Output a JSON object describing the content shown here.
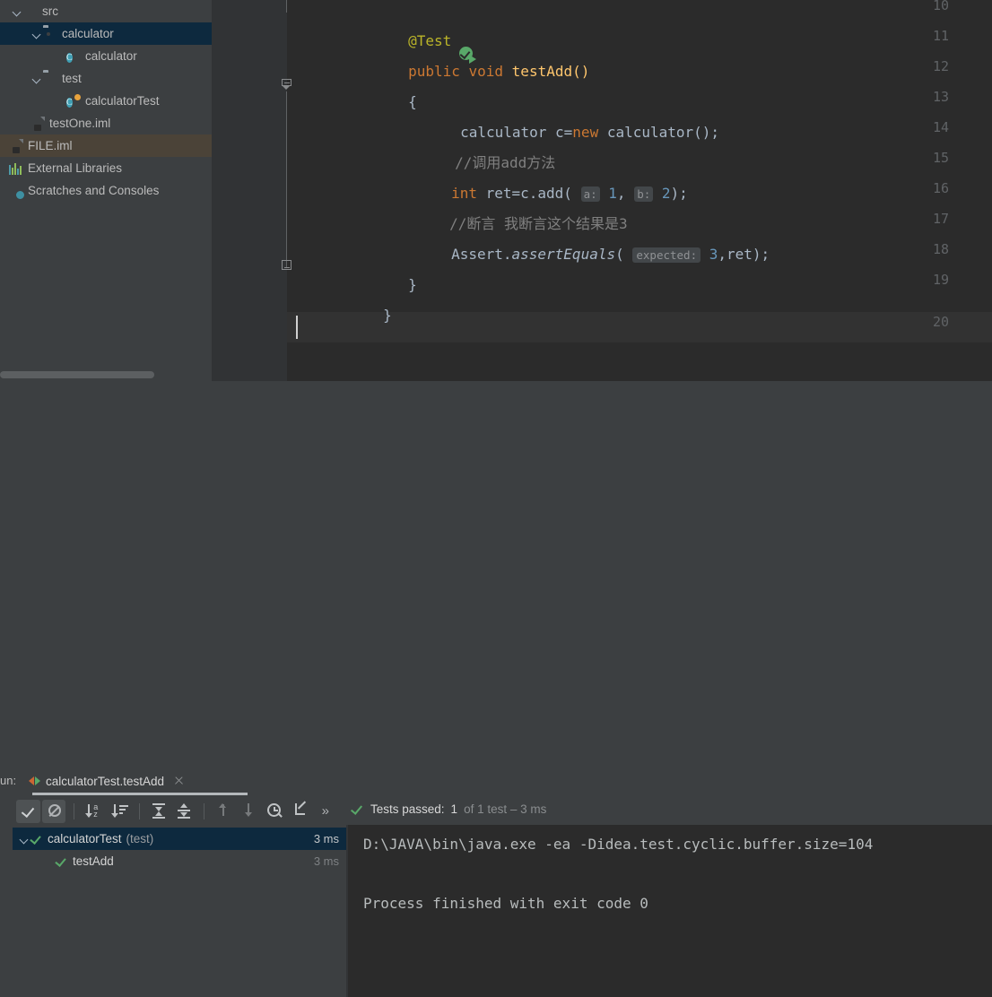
{
  "project": {
    "tree": [
      {
        "label": "src",
        "icon": "module-source-icon",
        "indent": 30,
        "chevron": true,
        "state": "normal"
      },
      {
        "label": "calculator",
        "icon": "package-folder-icon",
        "indent": 52,
        "chevron": true,
        "state": "selected"
      },
      {
        "label": "calculator",
        "icon": "java-class-icon",
        "indent": 76,
        "chevron": false,
        "state": "normal"
      },
      {
        "label": "test",
        "icon": "package-folder-icon",
        "indent": 52,
        "chevron": true,
        "state": "normal"
      },
      {
        "label": "calculatorTest",
        "icon": "java-test-class-icon",
        "indent": 76,
        "chevron": false,
        "state": "normal"
      },
      {
        "label": "testOne.iml",
        "icon": "iml-file-icon",
        "indent": 30,
        "chevron": false,
        "state": "normal"
      },
      {
        "label": "FILE.iml",
        "icon": "iml-file-icon",
        "indent": 8,
        "chevron": false,
        "state": "hover"
      },
      {
        "label": "External Libraries",
        "icon": "external-libraries-icon",
        "indent": 8,
        "chevron": false,
        "state": "normal"
      },
      {
        "label": "Scratches and Consoles",
        "icon": "scratches-consoles-icon",
        "indent": 8,
        "chevron": false,
        "state": "normal"
      }
    ]
  },
  "editor": {
    "line_numbers": [
      "10",
      "11",
      "12",
      "13",
      "14",
      "15",
      "16",
      "17",
      "18",
      "19",
      "20"
    ],
    "code": {
      "l10_annotation": "@Test",
      "l11_modifier": "public",
      "l11_type": "void",
      "l11_name": "testAdd()",
      "l12_brace": "{",
      "l13_type": "calculator",
      "l13_var": " c=",
      "l13_new": "new",
      "l13_ctor": " calculator();",
      "l14_comment": "//调用add方法",
      "l15_type": "int",
      "l15_call": " ret=c.add(",
      "l15_hint_a": "a:",
      "l15_arg_a": "1",
      "l15_comma": ",",
      "l15_hint_b": "b:",
      "l15_arg_b": "2",
      "l15_end": ");",
      "l16_comment": "//断言 我断言这个结果是3",
      "l17_class": "Assert.",
      "l17_method": "assertEquals",
      "l17_open": "(",
      "l17_hint": "expected:",
      "l17_val": "3",
      "l17_rest": ",ret);",
      "l18_brace": "}",
      "l19_brace": "}"
    }
  },
  "run_panel": {
    "run_label": "un:",
    "tab_title": "calculatorTest.testAdd",
    "toolbar": [
      {
        "name": "show-passed-button",
        "icon": "check-icon",
        "active": true
      },
      {
        "name": "show-ignored-button",
        "icon": "ban-icon",
        "active": true
      },
      {
        "name": "sort-alphabetically-button",
        "icon": "sort-alpha-icon",
        "active": false
      },
      {
        "name": "sort-by-duration-button",
        "icon": "sort-duration-icon",
        "active": false
      },
      {
        "name": "expand-all-button",
        "icon": "expand-all-icon",
        "active": false
      },
      {
        "name": "collapse-all-button",
        "icon": "collapse-all-icon",
        "active": false
      },
      {
        "name": "previous-failed-button",
        "icon": "arrow-up-icon",
        "active": false
      },
      {
        "name": "next-failed-button",
        "icon": "arrow-down-icon",
        "active": false
      },
      {
        "name": "test-history-button",
        "icon": "history-clock-icon",
        "active": false
      },
      {
        "name": "export-results-button",
        "icon": "export-icon",
        "active": false
      },
      {
        "name": "more-options-button",
        "icon": "chevron-double-right-icon",
        "active": false
      }
    ],
    "status": {
      "main": "Tests passed:",
      "count": "1",
      "detail": "of 1 test – 3 ms"
    },
    "tests": [
      {
        "name": "calculatorTest",
        "suffix": "(test)",
        "duration": "3 ms",
        "selected": true,
        "indent": 22,
        "chevron": true
      },
      {
        "name": "testAdd",
        "suffix": "",
        "duration": "3 ms",
        "selected": false,
        "indent": 48,
        "chevron": false
      }
    ],
    "console": {
      "line1": "D:\\JAVA\\bin\\java.exe -ea -Didea.test.cyclic.buffer.size=104",
      "line2": "Process finished with exit code 0"
    }
  }
}
